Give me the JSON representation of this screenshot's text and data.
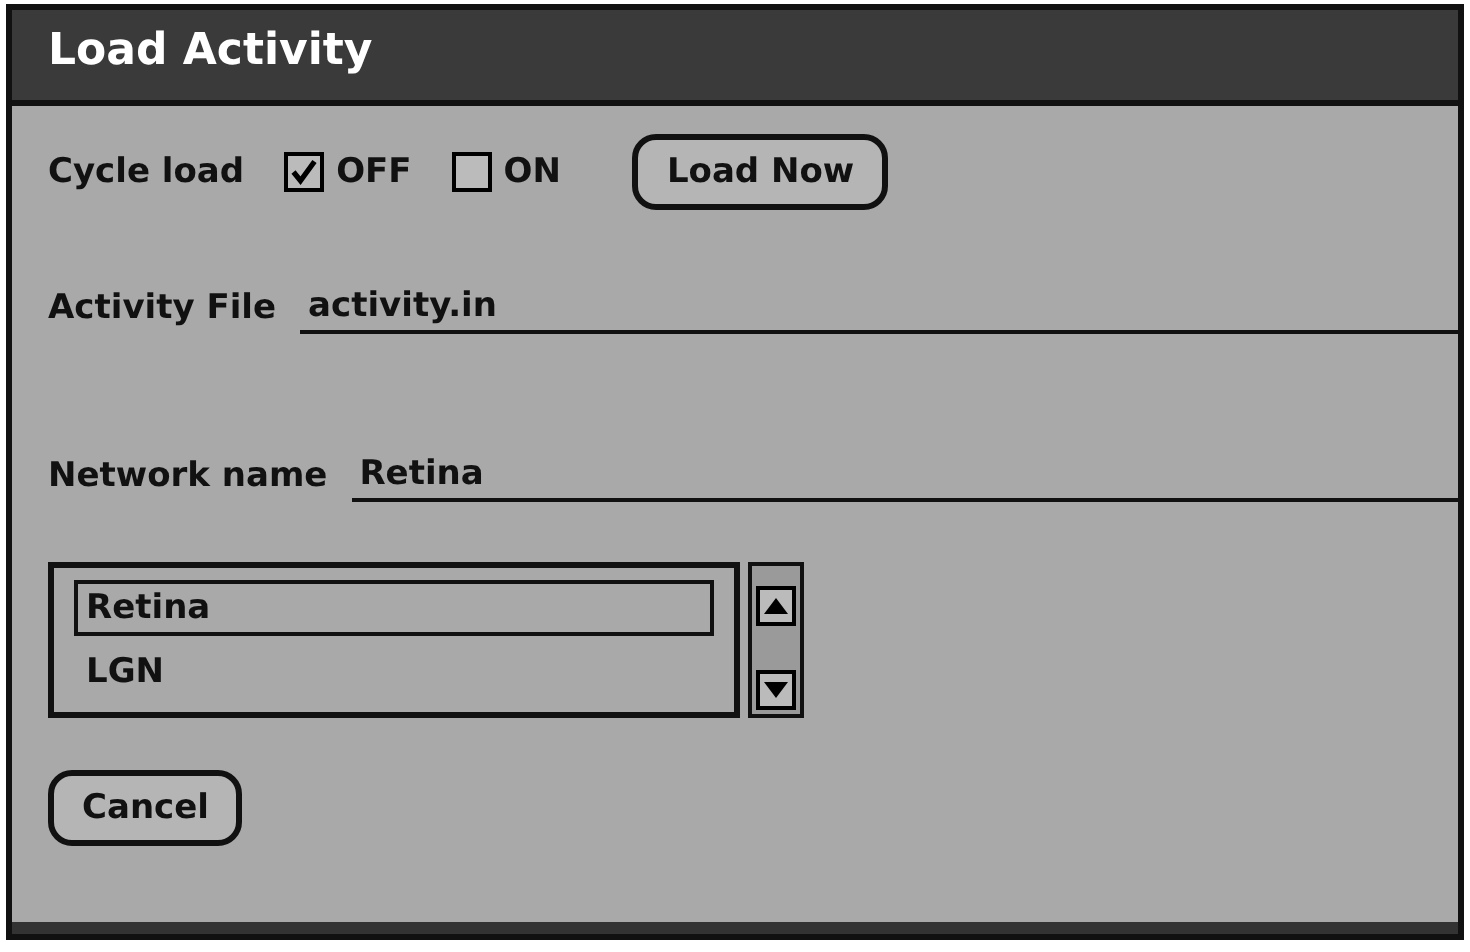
{
  "window": {
    "title": "Load Activity"
  },
  "cycle_load": {
    "label": "Cycle load",
    "options": [
      {
        "label": "OFF",
        "checked": true
      },
      {
        "label": "ON",
        "checked": false
      }
    ]
  },
  "load_button": "Load Now",
  "activity_file": {
    "label": "Activity File",
    "value": "activity.in"
  },
  "network_name": {
    "label": "Network name",
    "value": "Retina"
  },
  "network_list": [
    {
      "label": "Retina",
      "selected": true
    },
    {
      "label": "LGN",
      "selected": false
    }
  ],
  "cancel_button": "Cancel"
}
